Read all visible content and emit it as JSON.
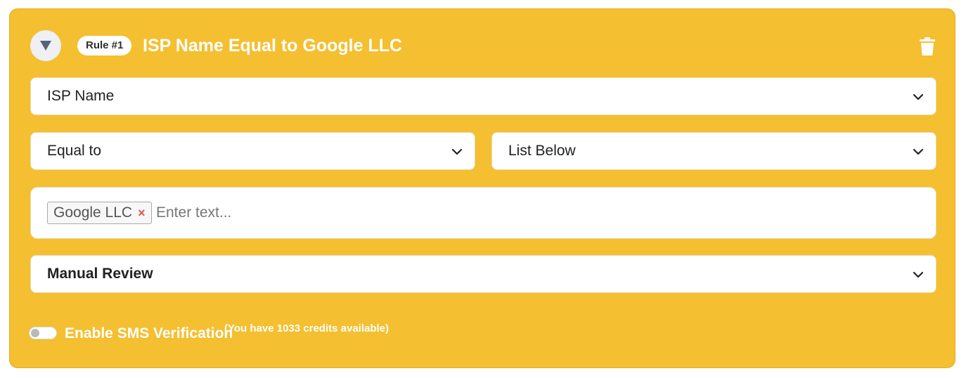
{
  "rule": {
    "badge": "Rule #1",
    "title": "ISP Name Equal to Google LLC",
    "collapse_icon": "triangle-down-icon",
    "delete_icon": "trash-icon"
  },
  "field_select": {
    "value": "ISP Name"
  },
  "operator_select": {
    "value": "Equal to"
  },
  "source_select": {
    "value": "List Below"
  },
  "tags_input": {
    "tags": [
      {
        "label": "Google LLC",
        "remove": "×"
      }
    ],
    "placeholder": "Enter text..."
  },
  "action_select": {
    "value": "Manual Review"
  },
  "sms": {
    "label": "Enable SMS Verification",
    "credits": "(You have 1033 credits available)",
    "enabled": false
  },
  "colors": {
    "card_background": "#f4bf30",
    "tag_remove": "#e05555"
  }
}
